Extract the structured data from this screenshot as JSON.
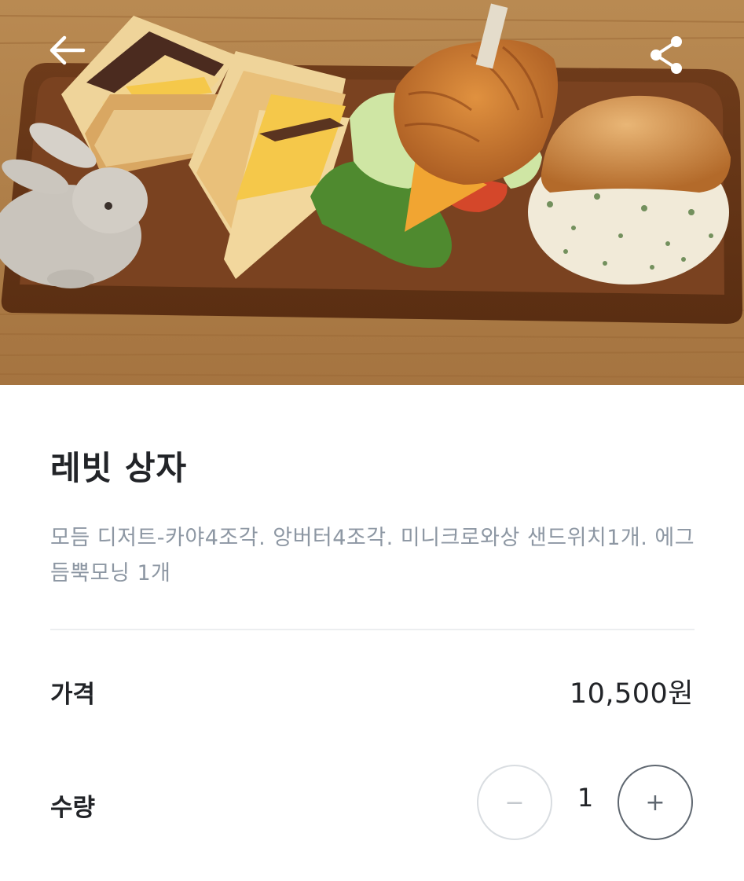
{
  "hero": {
    "image_alt": "",
    "back_icon": "arrow-left-icon",
    "share_icon": "share-icon"
  },
  "product": {
    "name": "레빗 상자",
    "description": "모듬 디저트-카야4조각. 앙버터4조각. 미니크로와상 샌드위치1개. 에그듬뿍모닝 1개"
  },
  "price": {
    "label": "가격",
    "value": "10,500원"
  },
  "quantity": {
    "label": "수량",
    "value": "1",
    "minus_label": "−",
    "plus_label": "+"
  },
  "colors": {
    "text_primary": "#222428",
    "text_secondary": "#8d97a3",
    "divider": "#eceef0",
    "stepper_disabled": "#d9dde1",
    "stepper_active": "#5f6770"
  }
}
